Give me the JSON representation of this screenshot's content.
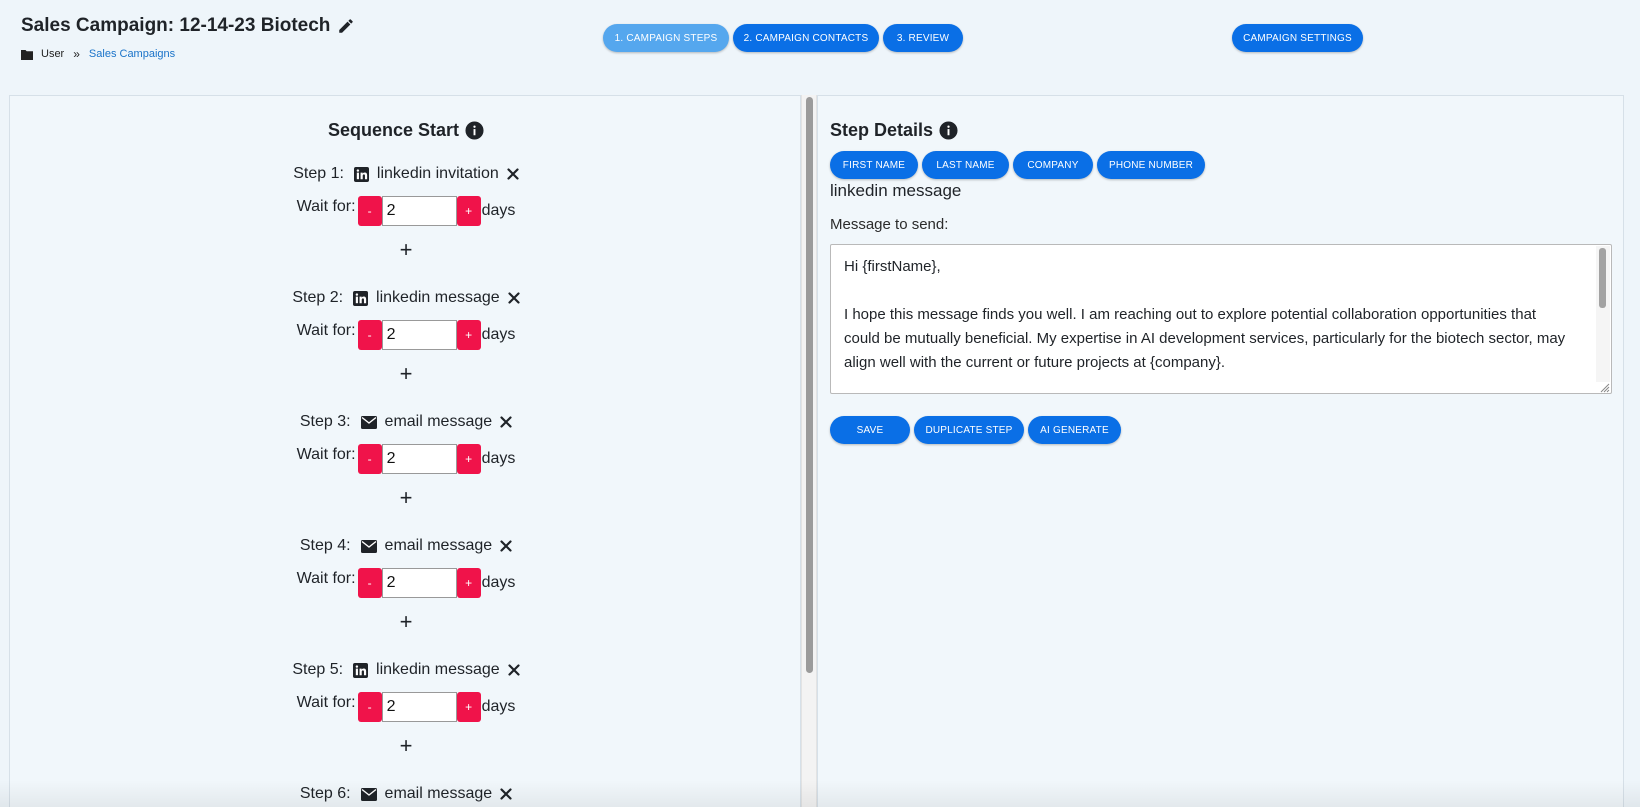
{
  "header": {
    "title": "Sales Campaign: 12-14-23 Biotech",
    "breadcrumb": {
      "root": "User",
      "separator": "»",
      "current": "Sales Campaigns"
    },
    "tabs": [
      {
        "label": "1. CAMPAIGN STEPS",
        "active": true
      },
      {
        "label": "2. CAMPAIGN CONTACTS",
        "active": false
      },
      {
        "label": "3. REVIEW",
        "active": false
      }
    ],
    "settings_label": "CAMPAIGN SETTINGS"
  },
  "sequence": {
    "title": "Sequence Start",
    "wait_label": "Wait for:",
    "days_label": "days",
    "minus_label": "-",
    "plus_label": "+",
    "add_step_label": "+",
    "steps": [
      {
        "label": "Step 1:",
        "channel_icon": "linkedin-icon",
        "type": "linkedin invitation",
        "wait": "2"
      },
      {
        "label": "Step 2:",
        "channel_icon": "linkedin-icon",
        "type": "linkedin message",
        "wait": "2"
      },
      {
        "label": "Step 3:",
        "channel_icon": "envelope-icon",
        "type": "email message",
        "wait": "2"
      },
      {
        "label": "Step 4:",
        "channel_icon": "envelope-icon",
        "type": "email message",
        "wait": "2"
      },
      {
        "label": "Step 5:",
        "channel_icon": "linkedin-icon",
        "type": "linkedin message",
        "wait": "2"
      },
      {
        "label": "Step 6:",
        "channel_icon": "envelope-icon",
        "type": "email message"
      }
    ]
  },
  "details": {
    "title": "Step Details",
    "placeholders": [
      "FIRST NAME",
      "LAST NAME",
      "COMPANY",
      "PHONE NUMBER"
    ],
    "step_name": "linkedin message",
    "message_label": "Message to send:",
    "message": "Hi {firstName},\n\nI hope this message finds you well. I am reaching out to explore potential collaboration opportunities that could be mutually beneficial. My expertise in AI development services, particularly for the biotech sector, may align well with the current or future projects at {company}.",
    "actions": {
      "save": "SAVE",
      "duplicate": "DUPLICATE STEP",
      "ai_generate": "AI GENERATE"
    }
  },
  "colors": {
    "primary": "#0a6fe6",
    "active_tab": "#55a7ee",
    "stepper": "#f0134a",
    "background": "#eef5fa",
    "link": "#1a73c9"
  }
}
